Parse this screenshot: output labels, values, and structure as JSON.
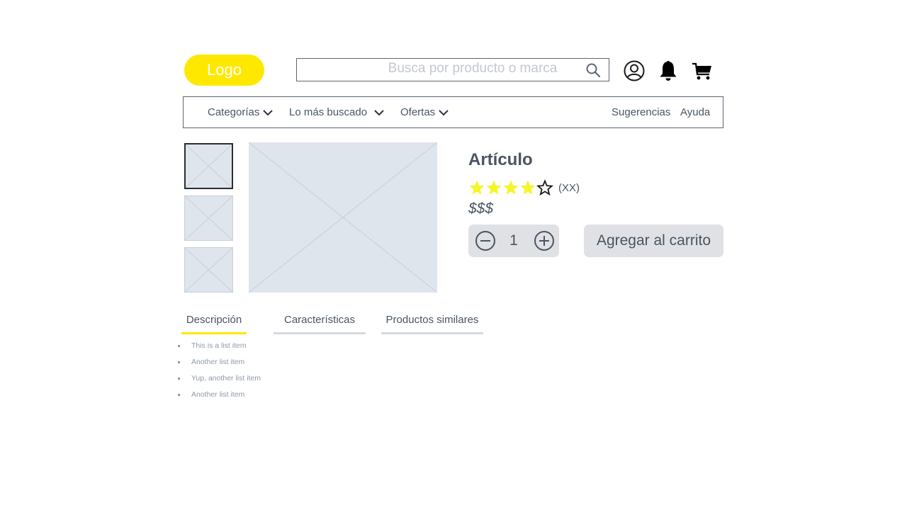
{
  "header": {
    "logo_text": "Logo",
    "search_placeholder": "Busca por producto o marca",
    "icons": [
      "search-icon",
      "user-account-icon",
      "bell-icon",
      "cart-icon"
    ]
  },
  "nav": {
    "items": [
      {
        "label": "Categorías",
        "has_dropdown": true
      },
      {
        "label": "Lo más buscado",
        "has_dropdown": true
      },
      {
        "label": "Ofertas",
        "has_dropdown": true
      }
    ],
    "right_items": [
      {
        "label": "Sugerencias"
      },
      {
        "label": "Ayuda"
      }
    ]
  },
  "product": {
    "title": "Artículo",
    "rating": 4,
    "rating_max": 5,
    "reviews": "(XX)",
    "price": "$$$",
    "quantity": "1",
    "add_to_cart_label": "Agregar al carrito",
    "thumbnails_count": 3,
    "selected_thumbnail": 1
  },
  "tabs": [
    {
      "label": "Descripción",
      "active": true
    },
    {
      "label": "Características",
      "active": false
    },
    {
      "label": "Productos similares",
      "active": false
    }
  ],
  "description_items": [
    "This is a list item",
    "Another list item",
    "Yup, another list item",
    "Another list item"
  ],
  "colors": {
    "accent": "#ffe800",
    "star_fill": "#f5f52a",
    "placeholder_bg": "#dfe5ed",
    "text": "#4a5561",
    "button_bg": "#dfe1e5"
  }
}
